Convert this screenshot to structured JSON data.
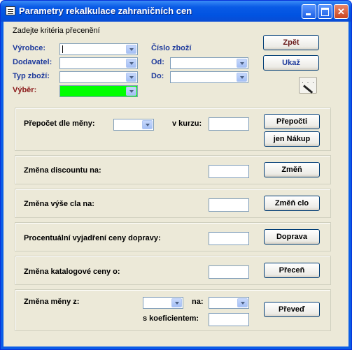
{
  "window": {
    "title": "Parametry rekalkulace zahraničních cen"
  },
  "criteria": {
    "heading": "Zadejte kritéria přecenění",
    "vyrobce_label": "Výrobce:",
    "dodavatel_label": "Dodavatel:",
    "typ_zbozi_label": "Typ zboží:",
    "vyber_label": "Výběr:",
    "cislo_zbozi_label": "Číslo zboží",
    "od_label": "Od:",
    "do_label": "Do:",
    "vyber_color": "#00ff00"
  },
  "buttons": {
    "zpet": "Zpět",
    "ukaz": "Ukaž",
    "prepocti": "Přepočti",
    "jen_nakup": "jen Nákup",
    "zmen": "Změň",
    "zmen_clo": "Změň clo",
    "doprava": "Doprava",
    "precen": "Přeceň",
    "preved": "Převeď"
  },
  "panels": {
    "prepocet_label": "Přepočet dle měny:",
    "v_kurzu_label": "v kurzu:",
    "discount_label": "Změna discountu na:",
    "clo_label": "Změna výše cla na:",
    "doprava_label": "Procentuální vyjadření ceny dopravy:",
    "katalog_label": "Změna katalogové ceny o:",
    "mena_z_label": "Změna měny z:",
    "na_label": "na:",
    "koeficient_label": "s koeficientem:"
  },
  "icons": {
    "app": "form-icon",
    "wand": "magic-wand-icon"
  }
}
